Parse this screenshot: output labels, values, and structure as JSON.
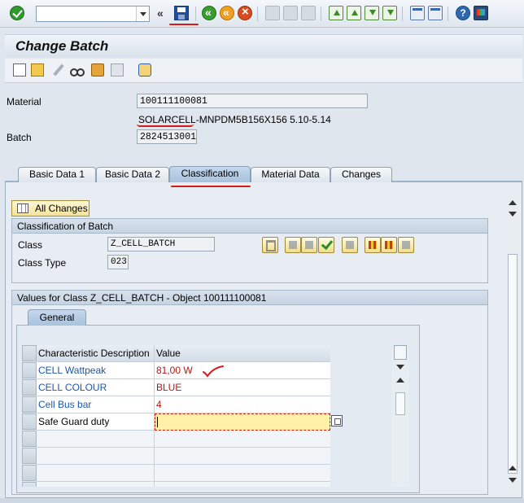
{
  "toolbar": {
    "command_field_value": "",
    "dbl_arrow": "«",
    "help_glyph": "?"
  },
  "title": "Change Batch",
  "header": {
    "material_label": "Material",
    "material_value": "100111100081",
    "material_desc": "SOLARCELL-MNPDM5B156X156 5.10-5.14",
    "batch_label": "Batch",
    "batch_value": "2824513001"
  },
  "tabs": [
    {
      "label": "Basic Data 1"
    },
    {
      "label": "Basic Data 2"
    },
    {
      "label": "Classification",
      "active": true
    },
    {
      "label": "Material Data"
    },
    {
      "label": "Changes"
    }
  ],
  "classification": {
    "all_changes_label": "All Changes",
    "group_title": "Classification of Batch",
    "class_label": "Class",
    "class_value": "Z_CELL_BATCH",
    "class_type_label": "Class Type",
    "class_type_value": "023"
  },
  "values": {
    "group_title": "Values for Class Z_CELL_BATCH - Object 100111100081",
    "inner_tab": "General",
    "columns": [
      "Characteristic Description",
      "Value"
    ],
    "rows": [
      {
        "desc": "CELL Wattpeak",
        "value": "81,00 W"
      },
      {
        "desc": "CELL COLOUR",
        "value": "BLUE"
      },
      {
        "desc": "Cell Bus bar",
        "value": "4"
      },
      {
        "desc": "Safe Guard duty",
        "value": ""
      }
    ]
  },
  "colors": {
    "link_blue": "#1d58a8",
    "value_red": "#b01818",
    "annotation_red": "#d21d1d",
    "input_yellow": "#fff1a8"
  },
  "icons": [
    "check-icon",
    "save-icon",
    "back-icon",
    "exit-icon",
    "cancel-icon",
    "print-icon",
    "find-icon",
    "first-page-icon",
    "prev-page-icon",
    "next-page-icon",
    "last-page-icon",
    "new-session-icon",
    "shortcut-icon",
    "help-icon",
    "layout-icon"
  ]
}
